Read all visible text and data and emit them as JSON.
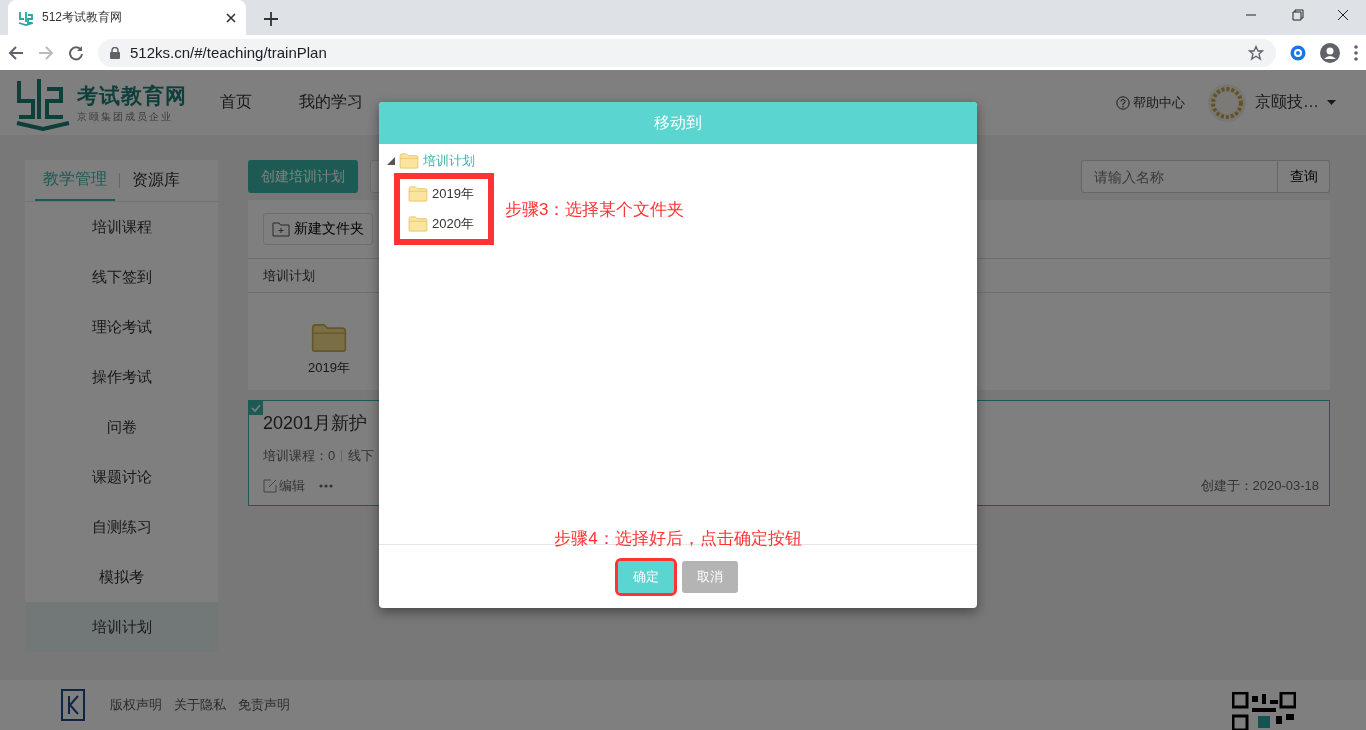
{
  "browser": {
    "tab_title": "512考试教育网",
    "url": "512ks.cn/#/teaching/trainPlan"
  },
  "header": {
    "logo_title": "考试教育网",
    "logo_subtitle": "京颐集团成员企业",
    "nav": [
      {
        "label": "首页"
      },
      {
        "label": "我的学习"
      }
    ],
    "help": "帮助中心",
    "user": "京颐技…"
  },
  "sidebar": {
    "tabs": [
      {
        "label": "教学管理",
        "selected": true
      },
      {
        "label": "资源库",
        "selected": false
      }
    ],
    "items": [
      {
        "label": "培训课程",
        "selected": false
      },
      {
        "label": "线下签到",
        "selected": false
      },
      {
        "label": "理论考试",
        "selected": false
      },
      {
        "label": "操作考试",
        "selected": false
      },
      {
        "label": "问卷",
        "selected": false
      },
      {
        "label": "课题讨论",
        "selected": false
      },
      {
        "label": "自测练习",
        "selected": false
      },
      {
        "label": "模拟考",
        "selected": false
      },
      {
        "label": "培训计划",
        "selected": true
      }
    ]
  },
  "toolbar": {
    "create_button": "创建培训计划",
    "search": {
      "placeholder": "请输入名称"
    },
    "search_button": "查询"
  },
  "panel": {
    "new_folder_button": "新建文件夹",
    "breadcrumb": "培训计划",
    "folders": [
      {
        "label": "2019年"
      }
    ]
  },
  "plan_card": {
    "checked": true,
    "title": "20201月新护",
    "stats": [
      "培训课程：0",
      "线下"
    ],
    "edit": "编辑",
    "created": "创建于：2020-03-18"
  },
  "footer": {
    "links": [
      "版权声明",
      "关于隐私",
      "免责声明"
    ]
  },
  "dialog": {
    "title": "移动到",
    "tree": {
      "label": "培训计划",
      "expanded": true,
      "highlighted_children": true,
      "children": [
        {
          "label": "2019年"
        },
        {
          "label": "2020年"
        }
      ]
    },
    "annotations": [
      "步骤3：选择某个文件夹",
      "步骤4：选择好后，点击确定按钮"
    ],
    "buttons": [
      {
        "label": "确定",
        "kind": "primary",
        "highlighted": true
      },
      {
        "label": "取消",
        "kind": "default",
        "highlighted": false
      }
    ]
  }
}
